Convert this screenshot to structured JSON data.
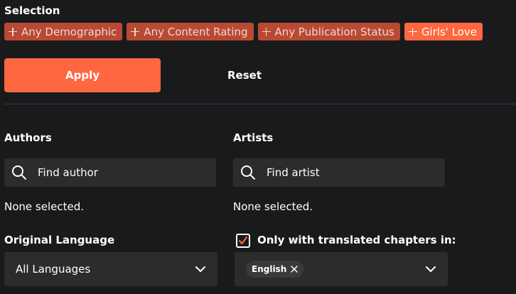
{
  "selection": {
    "title": "Selection",
    "chips": [
      {
        "label": "Any Demographic"
      },
      {
        "label": "Any Content Rating"
      },
      {
        "label": "Any Publication Status"
      },
      {
        "label": "Girls' Love"
      }
    ]
  },
  "actions": {
    "apply_label": "Apply",
    "reset_label": "Reset"
  },
  "authors": {
    "label": "Authors",
    "placeholder": "Find author",
    "note": "None selected."
  },
  "artists": {
    "label": "Artists",
    "placeholder": "Find artist",
    "note": "None selected."
  },
  "original_language": {
    "label": "Original Language",
    "value": "All Languages"
  },
  "translated": {
    "label": "Only with translated chapters in:",
    "checked": true,
    "selected_languages": [
      "English"
    ]
  },
  "colors": {
    "accent": "#ff6740",
    "chip_muted": "#b84a33",
    "background": "#191a1c",
    "field": "#2c2c2e"
  },
  "icons": {
    "chip": "plus-icon",
    "search": "search-icon",
    "dropdown": "chevron-down-icon",
    "remove": "close-icon",
    "check": "checkmark-icon"
  }
}
